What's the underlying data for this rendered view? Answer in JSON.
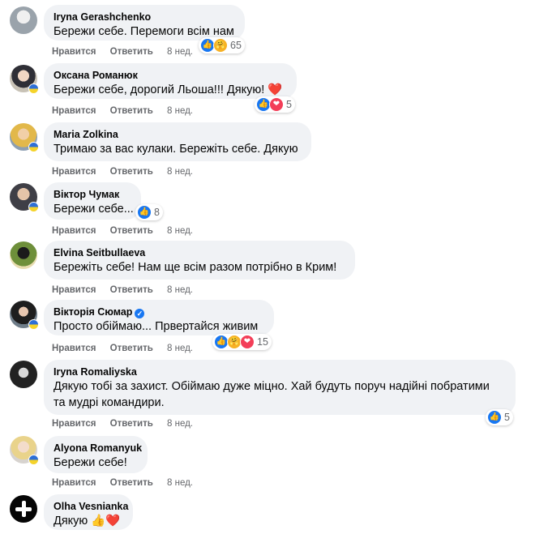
{
  "actions": {
    "like": "Нравится",
    "reply": "Ответить"
  },
  "icons": {
    "like": "👍",
    "love": "❤",
    "care": "🤗",
    "verified": "✓"
  },
  "colors": {
    "bubble": "#f0f2f5",
    "action": "#65676b",
    "like": "#1877f2",
    "love": "#f33e58"
  },
  "comments": [
    {
      "author": "Iryna Gerashchenko",
      "text": "Бережи себе. Перемоги всім нам",
      "time": "8 нед.",
      "reactions": [
        "like",
        "care"
      ],
      "count": "65"
    },
    {
      "author": "Оксана Романюк",
      "text": "Бережи себе, дорогий Льоша!!! Дякую! ❤️",
      "time": "8 нед.",
      "reactions": [
        "like",
        "love"
      ],
      "count": "5"
    },
    {
      "author": "Maria Zolkina",
      "text": "Тримаю за вас кулаки. Бережіть себе. Дякую",
      "time": "8 нед."
    },
    {
      "author": "Віктор Чумак",
      "text": "Бережи себе...",
      "time": "8 нед.",
      "reactions": [
        "like"
      ],
      "count": "8"
    },
    {
      "author": "Elvina Seitbullaeva",
      "text": "Бережіть себе! Нам ще всім разом потрібно в Крим!",
      "time": "8 нед."
    },
    {
      "author": "Вікторія Сюмар",
      "text": "Просто обіймаю... Првертайся живим",
      "time": "8 нед.",
      "reactions": [
        "like",
        "care",
        "love"
      ],
      "count": "15",
      "verified": true
    },
    {
      "author": "Iryna Romaliyska",
      "text": "Дякую тобі за захист. Обіймаю дуже міцно. Хай будуть поруч надійні побратими",
      "text2": "та мудрі командири.",
      "time": "8 нед.",
      "reactions": [
        "like"
      ],
      "count": "5"
    },
    {
      "author": "Alyona Romanyuk",
      "text": "Бережи себе!",
      "time": "8 нед."
    },
    {
      "author": "Olha Vesnianka",
      "text": "Дякую 👍❤️",
      "time": ""
    }
  ]
}
